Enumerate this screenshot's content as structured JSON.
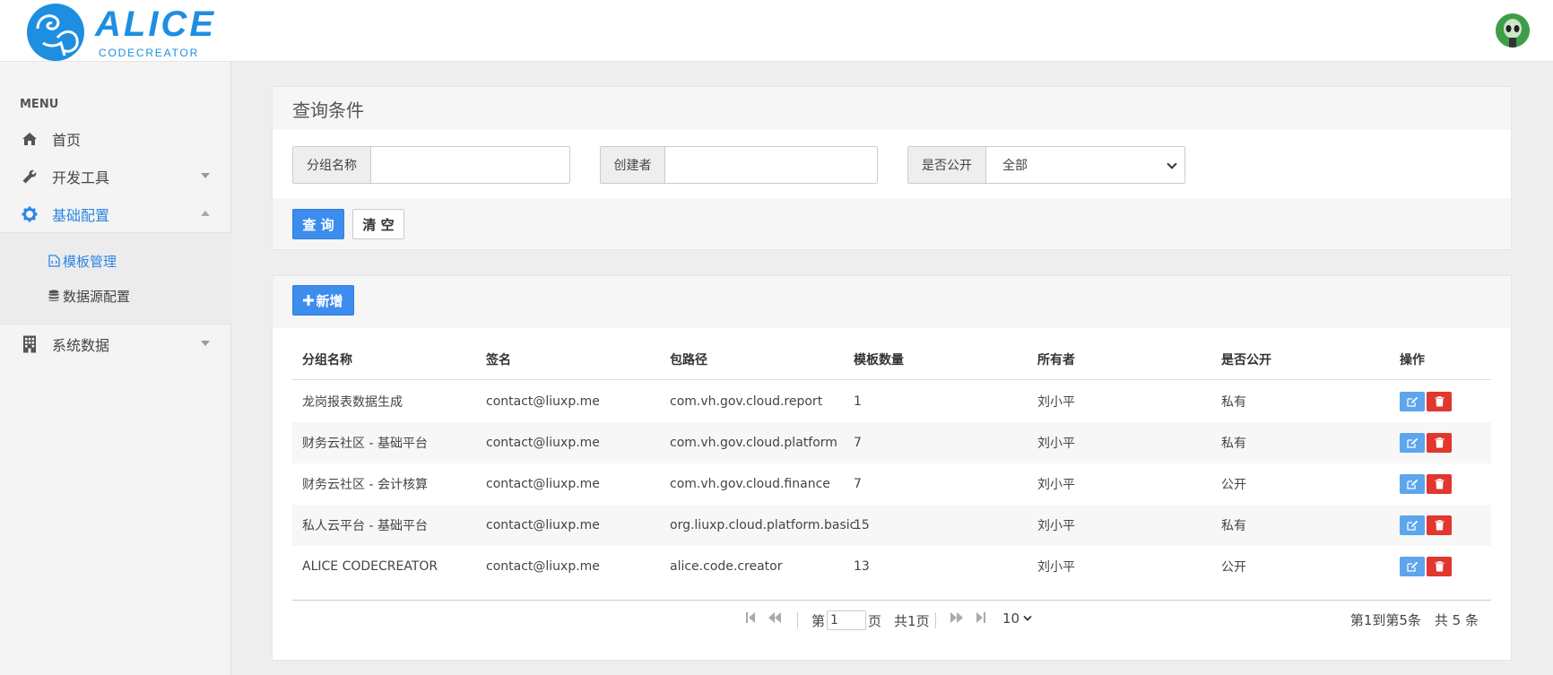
{
  "header": {
    "logo_title": "ALICE",
    "logo_subtitle": "CODECREATOR"
  },
  "sidebar": {
    "menu_header": "MENU",
    "items": [
      {
        "label": "首页",
        "icon": "home-icon"
      },
      {
        "label": "开发工具",
        "icon": "wrench-icon"
      },
      {
        "label": "基础配置",
        "icon": "gear-icon"
      },
      {
        "label": "系统数据",
        "icon": "building-icon"
      }
    ],
    "sub_items": [
      {
        "label": "模板管理",
        "icon": "code-file-icon"
      },
      {
        "label": "数据源配置",
        "icon": "database-icon"
      }
    ]
  },
  "query": {
    "title": "查询条件",
    "group_name_label": "分组名称",
    "group_name_value": "",
    "creator_label": "创建者",
    "creator_value": "",
    "public_label": "是否公开",
    "public_value": "全部",
    "search_button": "查 询",
    "clear_button": "清 空"
  },
  "list": {
    "add_button": "新增",
    "columns": [
      "分组名称",
      "签名",
      "包路径",
      "模板数量",
      "所有者",
      "是否公开",
      "操作"
    ],
    "rows": [
      [
        "龙岗报表数据生成",
        "contact@liuxp.me",
        "com.vh.gov.cloud.report",
        "1",
        "刘小平",
        "私有"
      ],
      [
        "财务云社区 - 基础平台",
        "contact@liuxp.me",
        "com.vh.gov.cloud.platform",
        "7",
        "刘小平",
        "私有"
      ],
      [
        "财务云社区 - 会计核算",
        "contact@liuxp.me",
        "com.vh.gov.cloud.finance",
        "7",
        "刘小平",
        "公开"
      ],
      [
        "私人云平台 - 基础平台",
        "contact@liuxp.me",
        "org.liuxp.cloud.platform.basic",
        "15",
        "刘小平",
        "私有"
      ],
      [
        "ALICE CODECREATOR",
        "contact@liuxp.me",
        "alice.code.creator",
        "13",
        "刘小平",
        "公开"
      ]
    ]
  },
  "pagination": {
    "page_prefix": "第",
    "page_value": "1",
    "page_suffix": "页",
    "total_pages": "共1页",
    "page_size": "10",
    "summary": "第1到第5条　共 5 条"
  },
  "colors": {
    "primary": "#3c8dee",
    "danger": "#e0372e",
    "brand": "#1e8fe0"
  }
}
